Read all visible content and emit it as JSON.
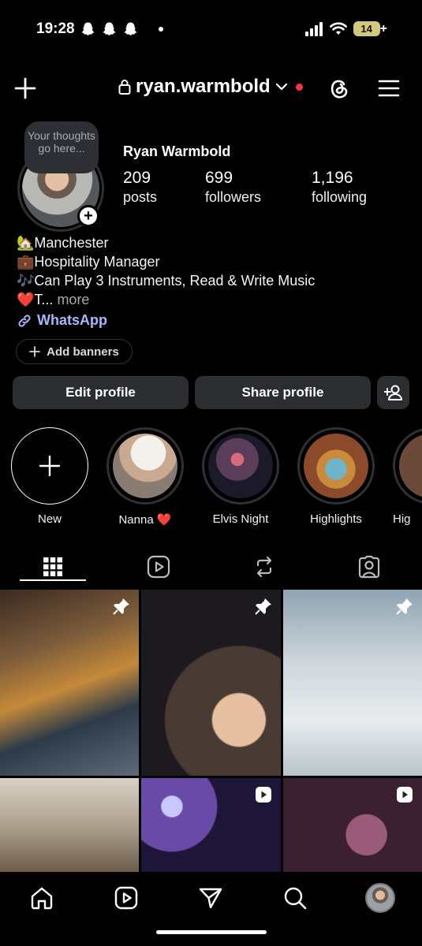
{
  "status_bar": {
    "time": "19:28",
    "battery": "14",
    "battery_plus": "+"
  },
  "header": {
    "username": "ryan.warmbold"
  },
  "profile": {
    "thought": "Your thoughts go here...",
    "name": "Ryan Warmbold",
    "stats": [
      {
        "value": "209",
        "label": "posts"
      },
      {
        "value": "699",
        "label": "followers"
      },
      {
        "value": "1,196",
        "label": "following"
      }
    ],
    "bio": [
      "🏡Manchester",
      "💼Hospitality Manager",
      "🎶Can Play 3 Instruments, Read & Write Music",
      "❤️T..."
    ],
    "bio_more": "more",
    "link": "WhatsApp",
    "add_banners": "Add banners"
  },
  "actions": {
    "edit": "Edit profile",
    "share": "Share profile"
  },
  "highlights": [
    {
      "label": "New"
    },
    {
      "label": "Nanna ❤️"
    },
    {
      "label": "Elvis Night"
    },
    {
      "label": "Highlights"
    },
    {
      "label": "Hig"
    }
  ],
  "tabs": [
    "grid-icon",
    "reels-icon",
    "reposts-icon",
    "tagged-icon"
  ],
  "colors": {
    "background": "#000000",
    "button": "#2b2d31",
    "link": "#a9b7ff",
    "notification_dot": "#ff3040"
  }
}
